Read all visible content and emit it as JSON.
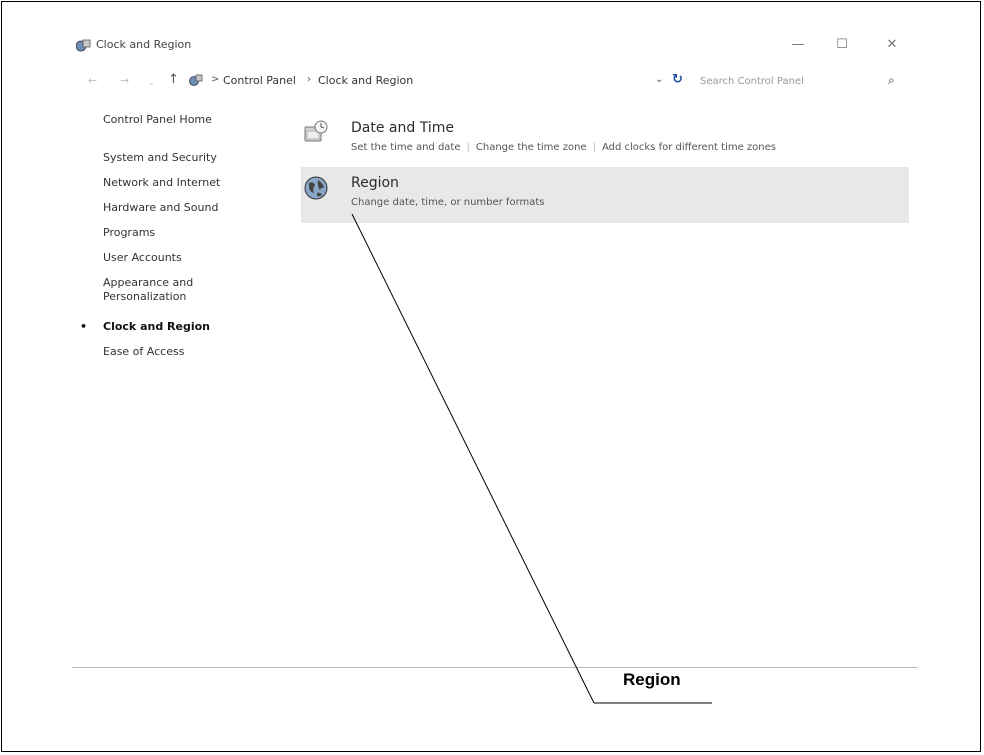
{
  "window": {
    "title": "Clock and Region",
    "controls": {
      "minimize": "—",
      "maximize": "☐",
      "close": "✕"
    }
  },
  "address_bar": {
    "breadcrumb_sep": ">",
    "breadcrumb": [
      "Control Panel",
      "Clock and Region"
    ],
    "breadcrumb_arrow": "›",
    "search_placeholder": "Search Control Panel",
    "icons": [
      "back-arrow-icon",
      "forward-arrow-icon",
      "up-arrow-icon",
      "control-panel-icon",
      "dropdown-icon",
      "refresh-icon",
      "search-icon"
    ]
  },
  "sidebar": {
    "items": [
      {
        "label": "Control Panel Home",
        "active": false
      },
      {
        "label": "System and Security",
        "active": false
      },
      {
        "label": "Network and Internet",
        "active": false
      },
      {
        "label": "Hardware and Sound",
        "active": false
      },
      {
        "label": "Programs",
        "active": false
      },
      {
        "label": "User Accounts",
        "active": false
      },
      {
        "label": "Appearance and",
        "label2": "Personalization",
        "active": false
      },
      {
        "label": "Clock and Region",
        "active": true
      },
      {
        "label": "Ease of Access",
        "active": false
      }
    ],
    "bullet": "•"
  },
  "main": {
    "categories": [
      {
        "title": "Date and Time",
        "icon": "clock-icon",
        "links": [
          "Set the time and date",
          "Change the time zone",
          "Add clocks for different time zones"
        ]
      },
      {
        "title": "Region",
        "icon": "globe-icon",
        "selected": true,
        "links": [
          "Change date, time, or number formats"
        ]
      }
    ]
  },
  "callout": {
    "label": "Region"
  }
}
